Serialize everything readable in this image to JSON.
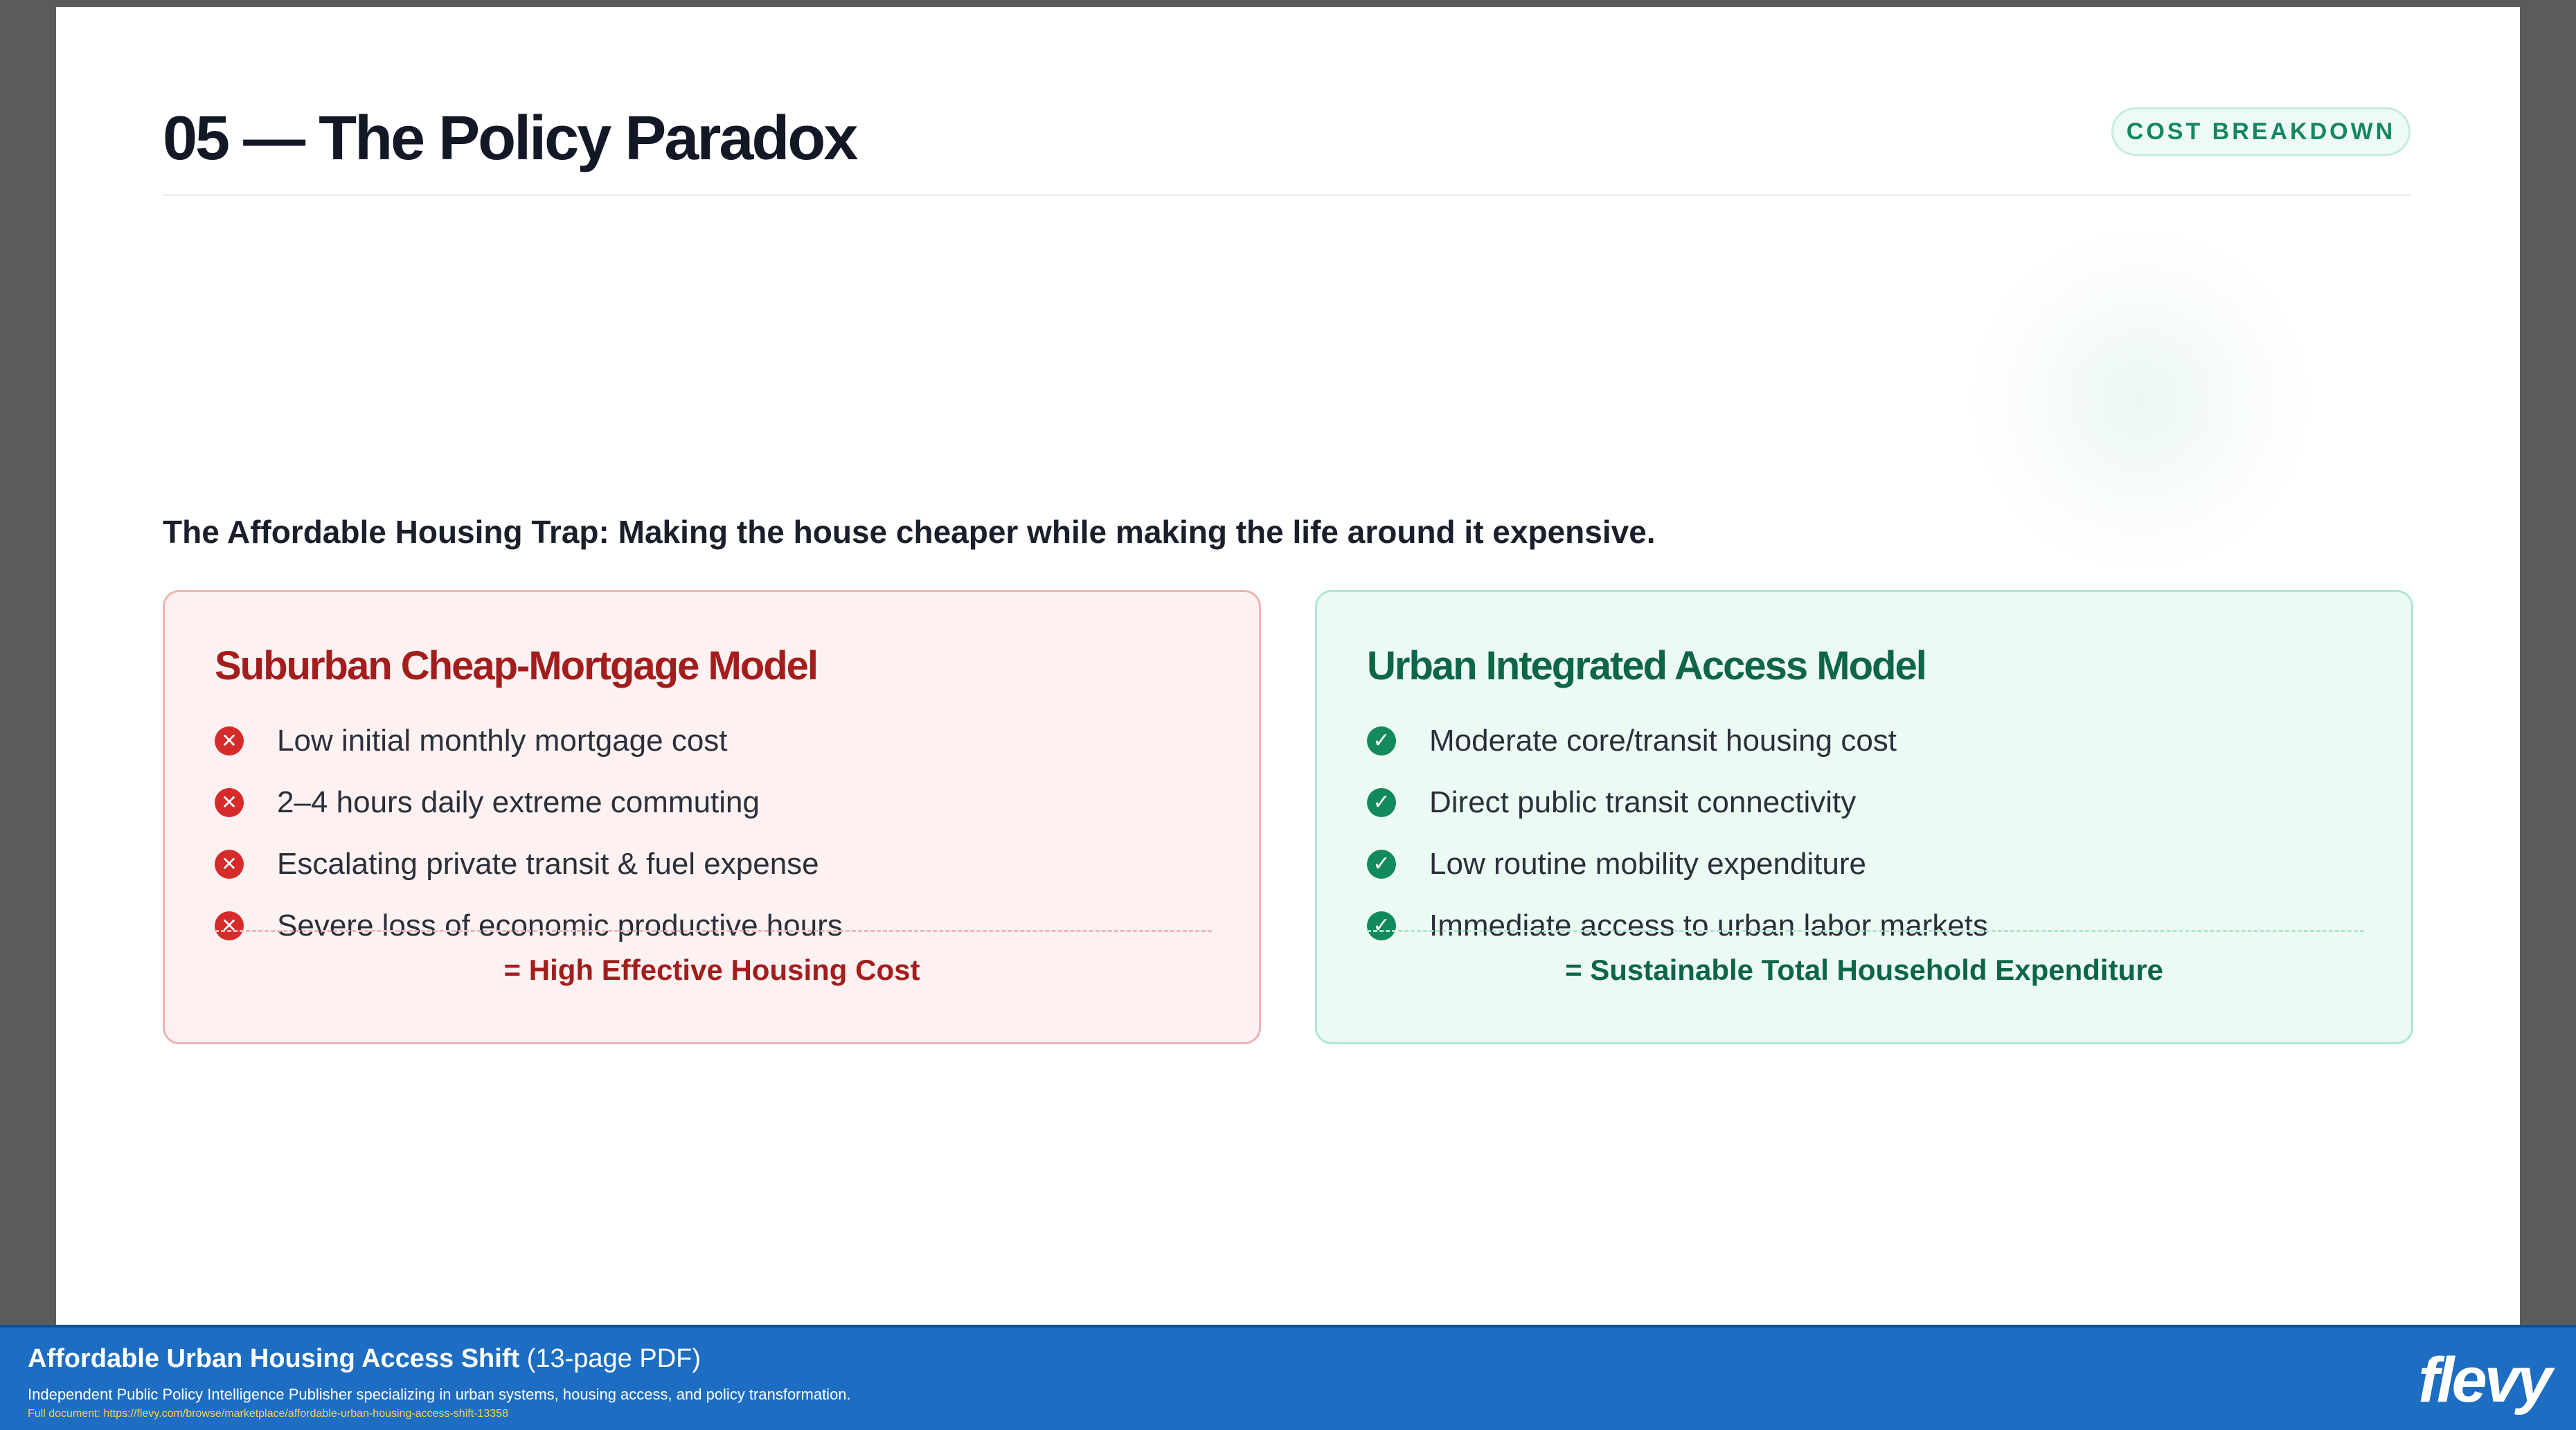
{
  "slide": {
    "title": "05 — The Policy Paradox",
    "badge": "COST BREAKDOWN",
    "subtitle": "The Affordable Housing Trap: Making the house cheaper while making the life around it expensive."
  },
  "cards": {
    "suburban": {
      "title": "Suburban Cheap-Mortgage Model",
      "icon": "x-circle-icon",
      "accent": "#a31d1d",
      "items": [
        "Low initial monthly mortgage cost",
        "2–4 hours daily extreme commuting",
        "Escalating private transit & fuel expense",
        "Severe loss of economic productive hours"
      ],
      "total": "= High Effective Housing Cost"
    },
    "urban": {
      "title": "Urban Integrated Access Model",
      "icon": "check-circle-icon",
      "accent": "#0d6645",
      "items": [
        "Moderate core/transit housing cost",
        "Direct public transit connectivity",
        "Low routine mobility expenditure",
        "Immediate access to urban labor markets"
      ],
      "total": "= Sustainable Total Household Expenditure"
    }
  },
  "footer": {
    "title": "Affordable Urban Housing Access Shift",
    "title_suffix": "(13-page PDF)",
    "description": "Independent Public Policy Intelligence Publisher specializing in urban systems, housing access, and policy transformation.",
    "link": "Full document: https://flevy.com/browse/marketplace/affordable-urban-housing-access-shift-13358",
    "logo": "flevy"
  }
}
